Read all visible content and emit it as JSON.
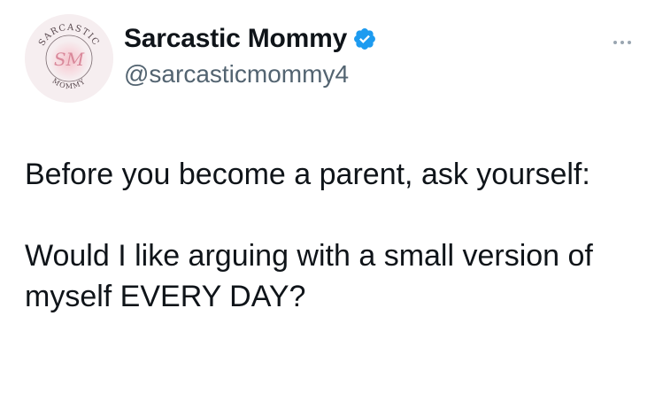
{
  "tweet": {
    "author": {
      "display_name": "Sarcastic Mommy",
      "handle": "@sarcasticmommy4",
      "verified": true,
      "verified_icon": "verified-badge-icon",
      "verified_color": "#1d9bf0",
      "avatar": {
        "text_top": "SARCASTIC",
        "monogram": "SM",
        "text_bottom": "MOMMY",
        "accent_color": "#e8a0ab"
      }
    },
    "more_icon": "more-horizontal-icon",
    "text_paragraph_1": "Before you become a parent, ask yourself:",
    "text_paragraph_2": "Would I like arguing with a small version of myself EVERY DAY?"
  }
}
